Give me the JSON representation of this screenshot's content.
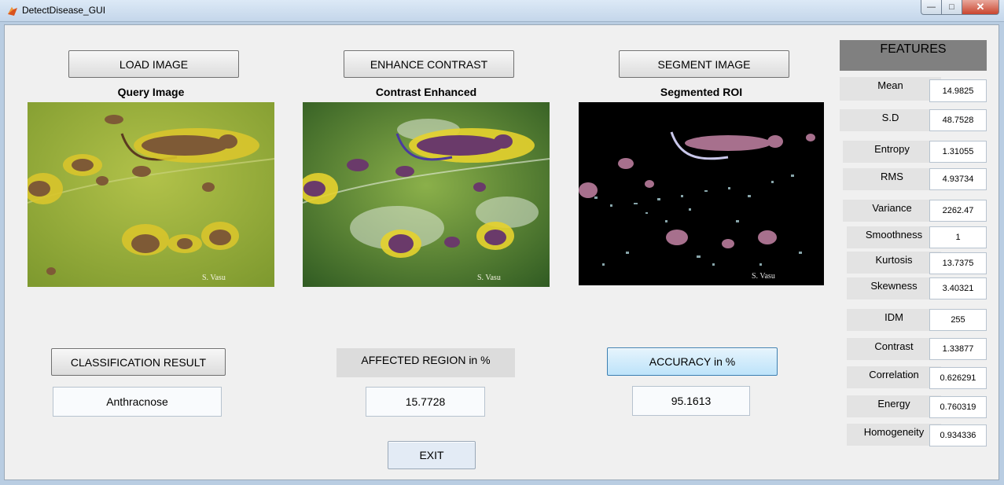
{
  "window": {
    "title": "DetectDisease_GUI",
    "icon": "matlab-icon"
  },
  "buttons": {
    "load": "LOAD IMAGE",
    "enhance": "ENHANCE CONTRAST",
    "segment": "SEGMENT IMAGE",
    "classify": "CLASSIFICATION RESULT",
    "accuracy": "ACCURACY in %",
    "exit": "EXIT"
  },
  "images": {
    "query": {
      "caption": "Query Image",
      "watermark": "S. Vasu"
    },
    "enhanced": {
      "caption": "Contrast Enhanced",
      "watermark": "S. Vasu"
    },
    "segmented": {
      "caption": "Segmented ROI",
      "watermark": "S. Vasu"
    }
  },
  "results": {
    "classification": "Anthracnose",
    "affected_label": "AFFECTED REGION in %",
    "affected_value": "15.7728",
    "accuracy_value": "95.1613"
  },
  "features": {
    "header": "FEATURES",
    "items": [
      {
        "label": "Mean",
        "value": "14.9825"
      },
      {
        "label": "S.D",
        "value": "48.7528"
      },
      {
        "label": "Entropy",
        "value": "1.31055"
      },
      {
        "label": "RMS",
        "value": "4.93734"
      },
      {
        "label": "Variance",
        "value": "2262.47"
      },
      {
        "label": "Smoothness",
        "value": "1"
      },
      {
        "label": "Kurtosis",
        "value": "13.7375"
      },
      {
        "label": "Skewness",
        "value": "3.40321"
      },
      {
        "label": "IDM",
        "value": "255"
      },
      {
        "label": "Contrast",
        "value": "1.33877"
      },
      {
        "label": "Correlation",
        "value": "0.626291"
      },
      {
        "label": "Energy",
        "value": "0.760319"
      },
      {
        "label": "Homogeneity",
        "value": "0.934336"
      }
    ]
  }
}
